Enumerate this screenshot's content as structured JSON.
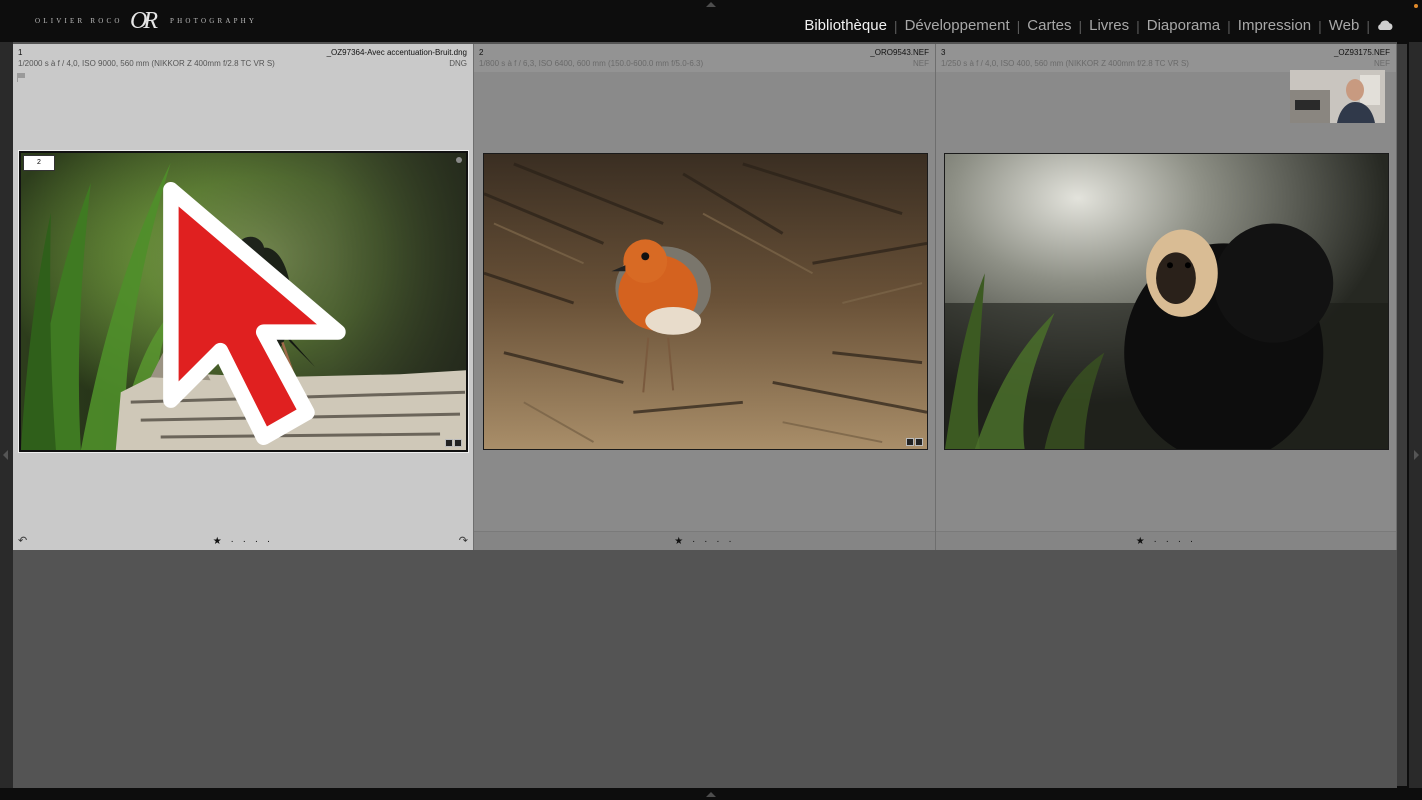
{
  "brand": {
    "left": "OLIVIER ROCO",
    "mark": "OR",
    "right": "PHOTOGRAPHY"
  },
  "modules": [
    {
      "label": "Bibliothèque",
      "active": true
    },
    {
      "label": "Développement"
    },
    {
      "label": "Cartes"
    },
    {
      "label": "Livres"
    },
    {
      "label": "Diaporama"
    },
    {
      "label": "Impression"
    },
    {
      "label": "Web"
    }
  ],
  "cells": [
    {
      "index": "1",
      "filename": "_OZ97364-Avec accentuation-Bruit.dng",
      "exif": "1/2000 s à f / 4,0, ISO 9000, 560 mm (NIKKOR Z 400mm f/2.8 TC VR S)",
      "ext": "DNG",
      "rating": "★ · · · ·",
      "stack_count": "2",
      "selected": true,
      "subject": "starling-on-birch-log"
    },
    {
      "index": "2",
      "filename": "_ORO9543.NEF",
      "exif": "1/800 s à f / 6,3, ISO 6400, 600 mm (150.0-600.0 mm f/5.0-6.3)",
      "ext": "NEF",
      "rating": "★ · · · ·",
      "subject": "robin-on-sand"
    },
    {
      "index": "3",
      "filename": "_OZ93175.NEF",
      "exif": "1/250 s à f / 4,0, ISO 400, 560 mm (NIKKOR Z 400mm f/2.8 TC VR S)",
      "ext": "NEF",
      "rating": "★ · · · ·",
      "subject": "white-faced-saki-monkey"
    }
  ],
  "colors": {
    "accent": "#e08a2a",
    "selected_cell": "#c9c9c9",
    "cell": "#8a8a8a",
    "grid_bg": "#545454",
    "cursor": "#e02020"
  }
}
